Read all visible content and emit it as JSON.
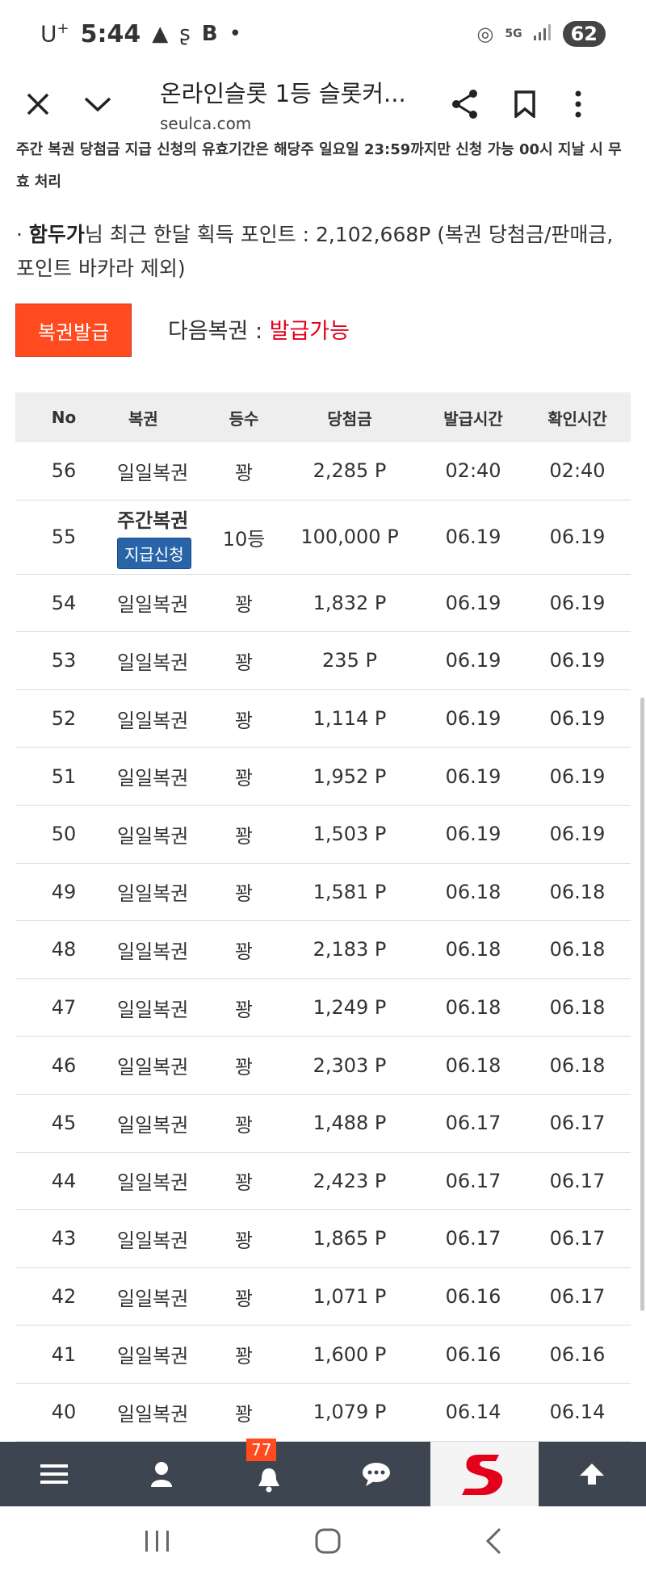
{
  "status_bar": {
    "carrier": "U",
    "carrier_sup": "+",
    "time": "5:44",
    "battery": "62"
  },
  "browser": {
    "title": "온라인슬롯 1등 슬롯커...",
    "url": "seulca.com"
  },
  "notice": {
    "text": "주간 복권 당첨금 지급 신청의 유효기간은 해당주 일요일 23:59까지만 신청 가능 00시 지날 시 무효 처리"
  },
  "points": {
    "prefix": "· ",
    "user": "함두가",
    "text": "님 최근 한달 획득 포인트 : 2,102,668P (복권 당첨금/판매금, 포인트 바카라 제외)"
  },
  "actions": {
    "issue_label": "복권발급",
    "next_label": "다음복권 : ",
    "next_status": "발급가능",
    "next_status_color": "#e3001b"
  },
  "table": {
    "headers": {
      "no": "No",
      "name": "복권",
      "rank": "등수",
      "prize": "당첨금",
      "issued": "발급시간",
      "checked": "확인시간"
    },
    "rows": [
      {
        "no": "56",
        "name": "일일복권",
        "rank": "꽝",
        "prize": "2,285 P",
        "issued": "02:40",
        "checked": "02:40"
      },
      {
        "no": "55",
        "name": "주간복권",
        "claim": "지급신청",
        "rank": "10등",
        "prize": "100,000 P",
        "issued": "06.19",
        "checked": "06.19"
      },
      {
        "no": "54",
        "name": "일일복권",
        "rank": "꽝",
        "prize": "1,832 P",
        "issued": "06.19",
        "checked": "06.19"
      },
      {
        "no": "53",
        "name": "일일복권",
        "rank": "꽝",
        "prize": "235 P",
        "issued": "06.19",
        "checked": "06.19"
      },
      {
        "no": "52",
        "name": "일일복권",
        "rank": "꽝",
        "prize": "1,114 P",
        "issued": "06.19",
        "checked": "06.19"
      },
      {
        "no": "51",
        "name": "일일복권",
        "rank": "꽝",
        "prize": "1,952 P",
        "issued": "06.19",
        "checked": "06.19"
      },
      {
        "no": "50",
        "name": "일일복권",
        "rank": "꽝",
        "prize": "1,503 P",
        "issued": "06.19",
        "checked": "06.19"
      },
      {
        "no": "49",
        "name": "일일복권",
        "rank": "꽝",
        "prize": "1,581 P",
        "issued": "06.18",
        "checked": "06.18"
      },
      {
        "no": "48",
        "name": "일일복권",
        "rank": "꽝",
        "prize": "2,183 P",
        "issued": "06.18",
        "checked": "06.18"
      },
      {
        "no": "47",
        "name": "일일복권",
        "rank": "꽝",
        "prize": "1,249 P",
        "issued": "06.18",
        "checked": "06.18"
      },
      {
        "no": "46",
        "name": "일일복권",
        "rank": "꽝",
        "prize": "2,303 P",
        "issued": "06.18",
        "checked": "06.18"
      },
      {
        "no": "45",
        "name": "일일복권",
        "rank": "꽝",
        "prize": "1,488 P",
        "issued": "06.17",
        "checked": "06.17"
      },
      {
        "no": "44",
        "name": "일일복권",
        "rank": "꽝",
        "prize": "2,423 P",
        "issued": "06.17",
        "checked": "06.17"
      },
      {
        "no": "43",
        "name": "일일복권",
        "rank": "꽝",
        "prize": "1,865 P",
        "issued": "06.17",
        "checked": "06.17"
      },
      {
        "no": "42",
        "name": "일일복권",
        "rank": "꽝",
        "prize": "1,071 P",
        "issued": "06.16",
        "checked": "06.17"
      },
      {
        "no": "41",
        "name": "일일복권",
        "rank": "꽝",
        "prize": "1,600 P",
        "issued": "06.16",
        "checked": "06.16"
      },
      {
        "no": "40",
        "name": "일일복권",
        "rank": "꽝",
        "prize": "1,079 P",
        "issued": "06.14",
        "checked": "06.14"
      }
    ]
  },
  "site_nav": {
    "notification_count": "77",
    "items": [
      "menu-icon",
      "user-icon",
      "bell-icon",
      "chat-icon",
      "site-logo",
      "arrow-up-icon"
    ]
  },
  "colors": {
    "accent": "#ff4b1f",
    "nav_bg": "#3d4550",
    "claim_button": "#2a64a8"
  }
}
